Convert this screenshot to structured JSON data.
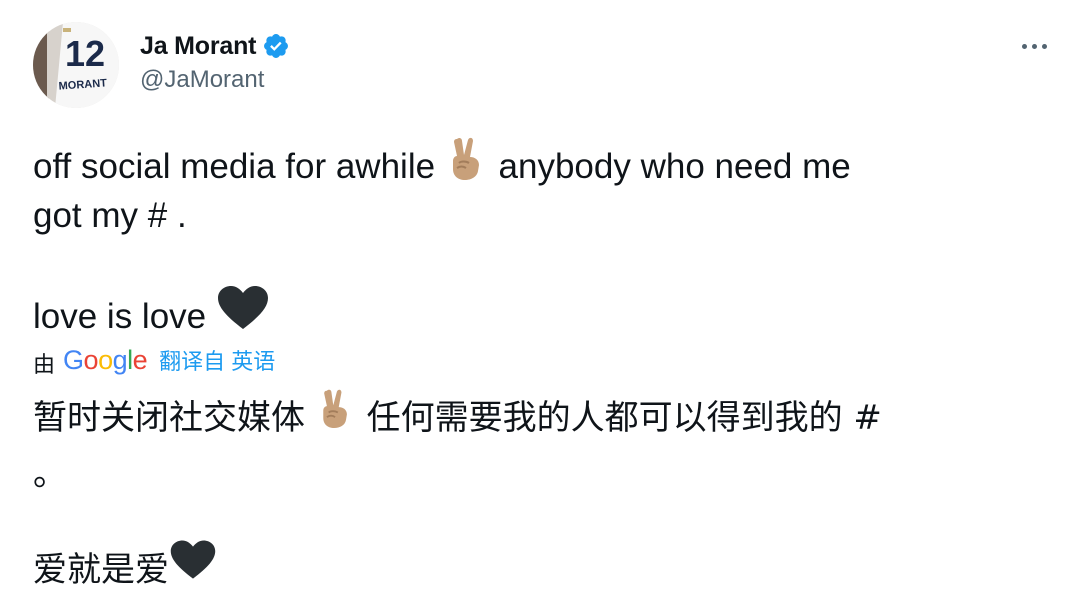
{
  "tweet": {
    "author": {
      "display_name": "Ja Morant",
      "handle": "@JaMorant",
      "verified": true,
      "avatar": {
        "jersey_number": "12",
        "jersey_name": "MORANT"
      }
    },
    "more_icon": "more-horizontal-icon",
    "text_lines": {
      "line1_a": "off social media for awhile",
      "line1_emoji": "victory-hand-emoji",
      "line1_b": "anybody who need me",
      "line2": "got my # .",
      "line3_a": "love is love",
      "line3_emoji": "black-heart-emoji"
    },
    "translation": {
      "by_label": "由",
      "provider": "Google",
      "link_label": "翻译自 英语",
      "line1_a": "暂时关闭社交媒体",
      "line1_b": "任何需要我的人都可以得到我的 #",
      "line2": "。",
      "line3": "爱就是爱"
    }
  },
  "colors": {
    "text": "#0f1419",
    "secondary": "#536471",
    "link": "#1d9bf0",
    "verified": "#1d9bf0"
  }
}
